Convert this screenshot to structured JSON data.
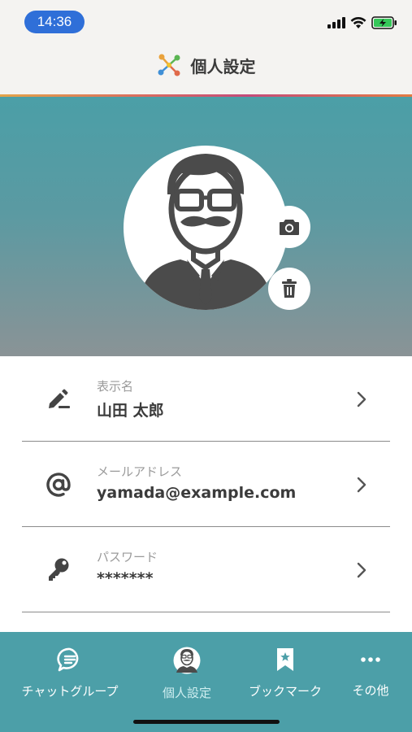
{
  "status_bar": {
    "time": "14:36"
  },
  "header": {
    "title": "個人設定"
  },
  "profile": {
    "icons": {
      "camera": "camera-icon",
      "trash": "trash-icon",
      "avatar": "man-glasses-mustache"
    }
  },
  "settings": {
    "items": [
      {
        "label": "表示名",
        "value": "山田 太郎",
        "icon": "pencil-icon"
      },
      {
        "label": "メールアドレス",
        "value": "yamada@example.com",
        "icon": "at-icon"
      },
      {
        "label": "パスワード",
        "value": "*******",
        "icon": "key-icon"
      }
    ]
  },
  "tabs": [
    {
      "label": "チャットグループ",
      "icon": "chat-icon",
      "active": false
    },
    {
      "label": "個人設定",
      "icon": "avatar-icon",
      "active": true
    },
    {
      "label": "ブックマーク",
      "icon": "bookmark-icon",
      "active": false
    },
    {
      "label": "その他",
      "icon": "more-icon",
      "active": false
    }
  ],
  "colors": {
    "accent_teal": "#4c9fa8",
    "time_pill": "#2f6fd8",
    "header_bg": "#f4f3f1",
    "text_dark": "#3b3b3b",
    "text_muted": "#9a9a9a"
  }
}
